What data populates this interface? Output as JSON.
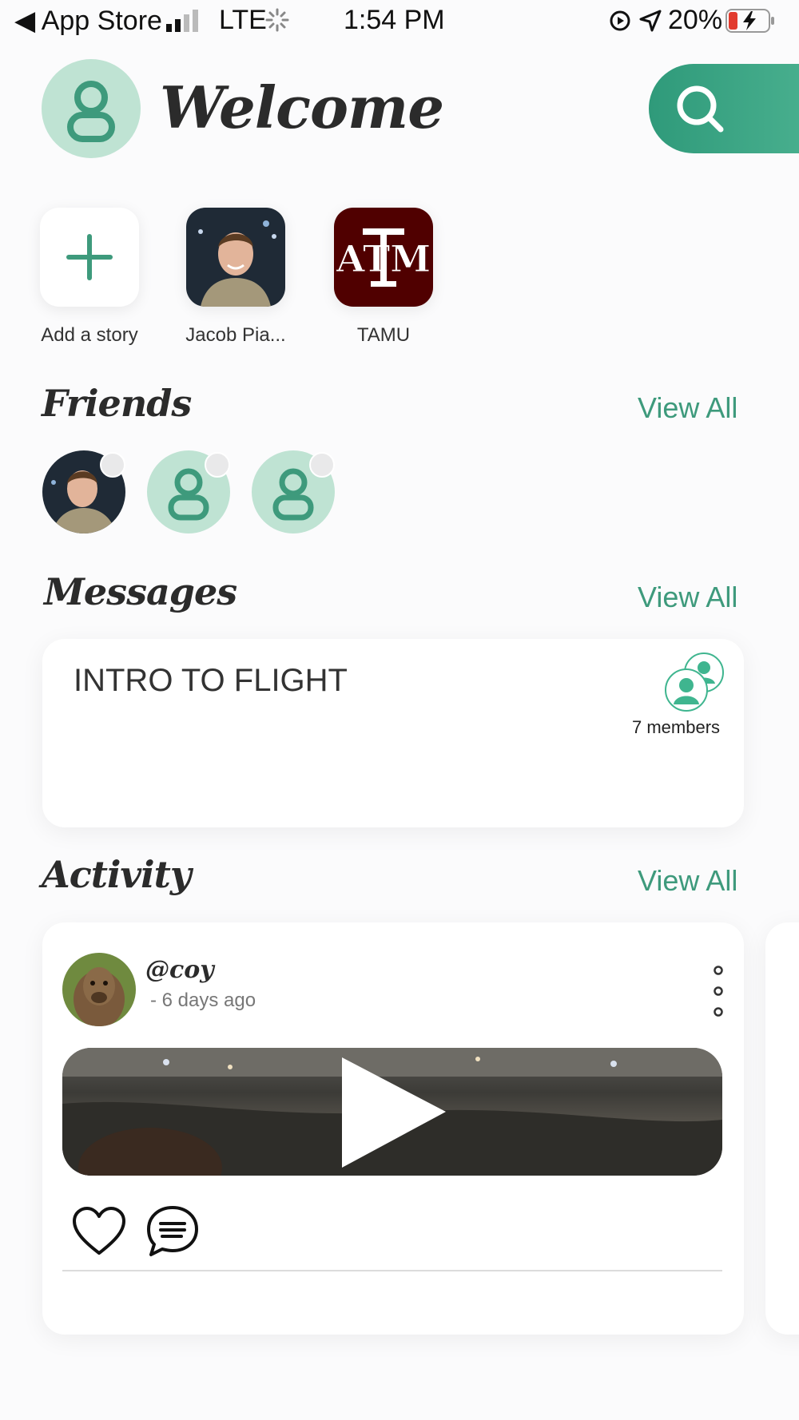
{
  "status_bar": {
    "back_label": "◀ App Store",
    "network": "LTE",
    "time": "1:54 PM",
    "battery": "20%"
  },
  "header": {
    "title": "Welcome"
  },
  "stories": [
    {
      "label": "Add a story"
    },
    {
      "label": "Jacob  Pia..."
    },
    {
      "label": "TAMU",
      "logo_text": "ATM"
    }
  ],
  "friends": {
    "title": "Friends",
    "view_all": "View All"
  },
  "messages": {
    "title": "Messages",
    "view_all": "View All",
    "group": {
      "name": "INTRO TO FLIGHT",
      "members": "7 members"
    }
  },
  "activity": {
    "title": "Activity",
    "view_all": "View All",
    "post": {
      "handle": "@coy",
      "time_ago": "- 6 days ago"
    }
  },
  "colors": {
    "accent": "#3e9a7c",
    "avatar_bg": "#bfe3d3",
    "tamu_maroon": "#500000"
  }
}
